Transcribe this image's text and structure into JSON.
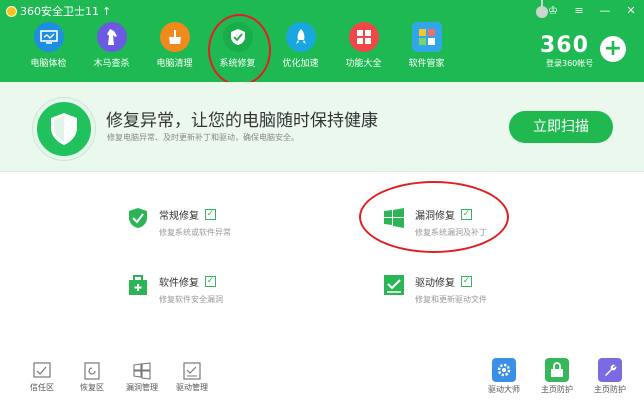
{
  "window": {
    "title": "360安全卫士11",
    "update_arrow": "↑"
  },
  "win_controls": {
    "skin": "♔",
    "menu": "≡",
    "minimize": "—",
    "close": "✕"
  },
  "nav": [
    {
      "label": "电脑体检",
      "icon": "monitor-check-icon",
      "color": "#1e8fe0"
    },
    {
      "label": "木马查杀",
      "icon": "horse-icon",
      "color": "#6a5be0"
    },
    {
      "label": "电脑清理",
      "icon": "broom-icon",
      "color": "#f08a1c"
    },
    {
      "label": "系统修复",
      "icon": "shield-icon",
      "color": "#19ad4a"
    },
    {
      "label": "优化加速",
      "icon": "rocket-icon",
      "color": "#1aa7e0"
    },
    {
      "label": "功能大全",
      "icon": "grid-icon",
      "color": "#f04848"
    },
    {
      "label": "软件管家",
      "icon": "software-icon",
      "color": "#31a7e9"
    }
  ],
  "brand": {
    "logo": "360",
    "account": "登录360帐号"
  },
  "hero": {
    "title": "修复异常，让您的电脑随时保持健康",
    "subtitle": "修复电脑异常、及时更新补丁和驱动，确保电脑安全。",
    "scan_button": "立即扫描"
  },
  "repairs": [
    {
      "name": "常规修复",
      "desc": "修复系统或软件异常",
      "icon": "shield-check-icon"
    },
    {
      "name": "漏洞修复",
      "desc": "修复系统漏洞及补丁",
      "icon": "windows-icon"
    },
    {
      "name": "软件修复",
      "desc": "修复软件安全漏洞",
      "icon": "bag-icon"
    },
    {
      "name": "驱动修复",
      "desc": "修复和更新驱动文件",
      "icon": "driver-icon"
    }
  ],
  "bottom_left": [
    {
      "label": "信任区",
      "icon": "trust-icon"
    },
    {
      "label": "恢复区",
      "icon": "restore-icon"
    },
    {
      "label": "漏洞管理",
      "icon": "window-grid-icon"
    },
    {
      "label": "驱动管理",
      "icon": "driver-manage-icon"
    }
  ],
  "bottom_right": [
    {
      "label": "驱动大师",
      "icon": "gear-icon",
      "color": "#3a8fe6"
    },
    {
      "label": "主页防护",
      "icon": "lock-icon",
      "color": "#36b85a"
    },
    {
      "label": "主页防护",
      "icon": "wrench-icon",
      "color": "#7a6be3"
    }
  ],
  "colors": {
    "topbar": "#1fb954",
    "accent": "#20b94f",
    "annotation": "#e02020"
  }
}
